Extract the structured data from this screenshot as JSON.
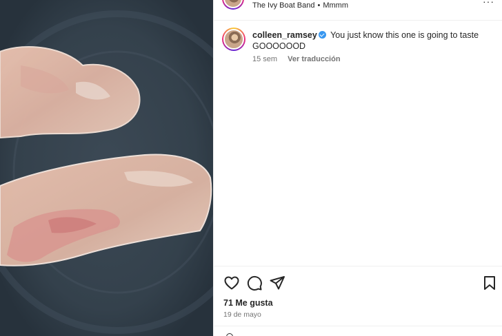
{
  "post": {
    "audio_artist": "The Ivy Boat Band",
    "audio_track": "Mmmm",
    "more_label": "···"
  },
  "caption": {
    "username": "colleen_ramsey",
    "text": "You just know this one is going to taste GOOOOOOD",
    "time": "15 sem",
    "translate_label": "Ver traducción"
  },
  "stats": {
    "likes": "71 Me gusta",
    "date": "19 de mayo"
  },
  "icons": {
    "like": "heart-icon",
    "comment": "comment-icon",
    "share": "paper-plane-icon",
    "save": "bookmark-icon",
    "verified": "verified-badge-icon"
  },
  "colors": {
    "verified": "#3897f0",
    "muted_text": "#737373",
    "pan": "#33404b"
  }
}
